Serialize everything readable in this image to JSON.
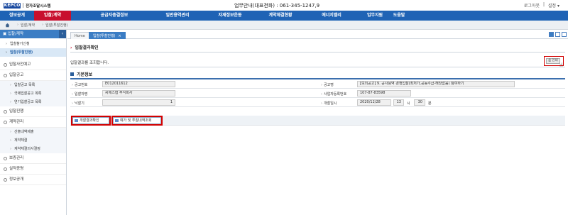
{
  "header": {
    "logo": "KEPCO",
    "system_name": "전자조달시스템",
    "hotline": "업무안내(대표전화) : 061-345-1247,9",
    "logout": "로그아웃",
    "settings": "설정 ▾"
  },
  "nav": [
    "정보공개",
    "입찰/계약",
    "공급자총결정보",
    "일반용역관리",
    "자재정보운동",
    "계약체결현황",
    "에너지밸리",
    "업무지원",
    "도움말"
  ],
  "breadcrumb": [
    "입찰/계약",
    "입찰(투찰진행)"
  ],
  "sidebar": {
    "title": "입찰/계약",
    "top_items": [
      {
        "label": "입찰참가신청",
        "selected": false
      },
      {
        "label": "입찰(투찰진행)",
        "selected": true
      }
    ],
    "groups": [
      {
        "label": "입찰사전예고",
        "children": []
      },
      {
        "label": "입찰공고",
        "children": [
          "입찰공고 목록",
          "국제입찰공고 목록",
          "연기입찰공고 목록"
        ]
      },
      {
        "label": "입찰진행",
        "children": []
      },
      {
        "label": "계약관리",
        "children": [
          "산출내역제출",
          "계약체결",
          "계약체결의사결정"
        ]
      },
      {
        "label": "보증관리",
        "children": []
      },
      {
        "label": "실적증명",
        "children": []
      },
      {
        "label": "정보공개",
        "children": []
      }
    ]
  },
  "tabs": [
    {
      "label": "Home",
      "active": false
    },
    {
      "label": "입찰(투찰진행)",
      "active": true
    }
  ],
  "page": {
    "title": "입찰결과확인",
    "description": "입찰결과를 조회합니다.",
    "print_label": "인쇄",
    "section_title": "기본정보"
  },
  "form": {
    "notice_no_label": "공고번호",
    "notice_no": "E012011612",
    "notice_name_label": "공고명",
    "notice_name": "[모의공고] 9. 공사용역 경쟁입찰(최저가,공동수급-해당없음) 참여하기",
    "bidder_label": "입찰자명",
    "bidder": "씨에스협 주식회사",
    "biz_no_label": "사업자등록번호",
    "biz_no": "107-87-83598",
    "round_label": "낙찰기",
    "round": "1",
    "open_label": "개찰일시",
    "open_date": "2020/12/28",
    "open_hour": "13",
    "hour_unit": "시",
    "open_min": "30",
    "min_unit": "분"
  },
  "actions": {
    "result_btn": "개찰결과확인",
    "price_btn": "예가 및 투찰내역조회"
  },
  "colors": {
    "nav": "#1f63b5",
    "nav_active": "#c8102e",
    "highlight": "#d20000",
    "sidebar_head": "#3b7dc4"
  }
}
